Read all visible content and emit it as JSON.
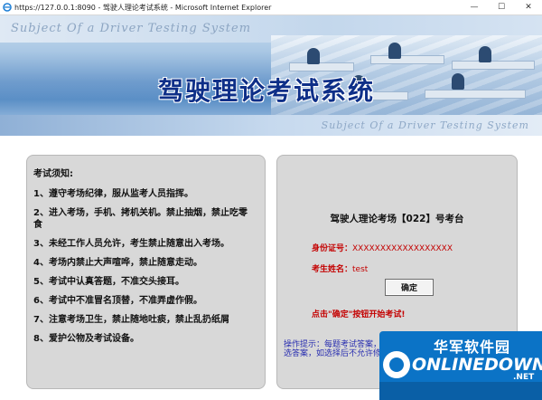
{
  "window": {
    "title": "https://127.0.0.1:8090 - 驾驶人理论考试系统 - Microsoft Internet Explorer",
    "minimize": "—",
    "maximize": "☐",
    "close": "✕"
  },
  "banner": {
    "subject_top": "Subject Of a Driver Testing System",
    "title": "驾驶理论考试系统",
    "subject_bottom": "Subject Of a Driver Testing System"
  },
  "notice": {
    "heading": "考试须知:",
    "items": [
      "1、遵守考场纪律，服从监考人员指挥。",
      "2、进入考场，手机、拷机关机。禁止抽烟，禁止吃零食",
      "3、未经工作人员允许，考生禁止随意出入考场。",
      "4、考场内禁止大声喧哗，禁止随意走动。",
      "5、考试中认真答题，不准交头接耳。",
      "6、考试中不准冒名顶替，不准弄虚作假。",
      "7、注意考场卫生，禁止随地吐痰，禁止乱扔纸屑",
      "8、爱护公物及考试设备。"
    ]
  },
  "login": {
    "exam_room": "驾驶人理论考场【022】号考台",
    "id_label": "身份证号：",
    "id_value": "XXXXXXXXXXXXXXXXXX",
    "name_label": "考生姓名：",
    "name_value": "test",
    "ok_button": "确定",
    "hint": "点击\"确定\"按钮开始考试!",
    "op_tip": "操作提示：每题考试答案，即判定所选答案，如选择后不允许修改答案。"
  },
  "watermark": {
    "cn": "华军软件园",
    "en": "ONLINEDOWN",
    "net": ".NET"
  }
}
